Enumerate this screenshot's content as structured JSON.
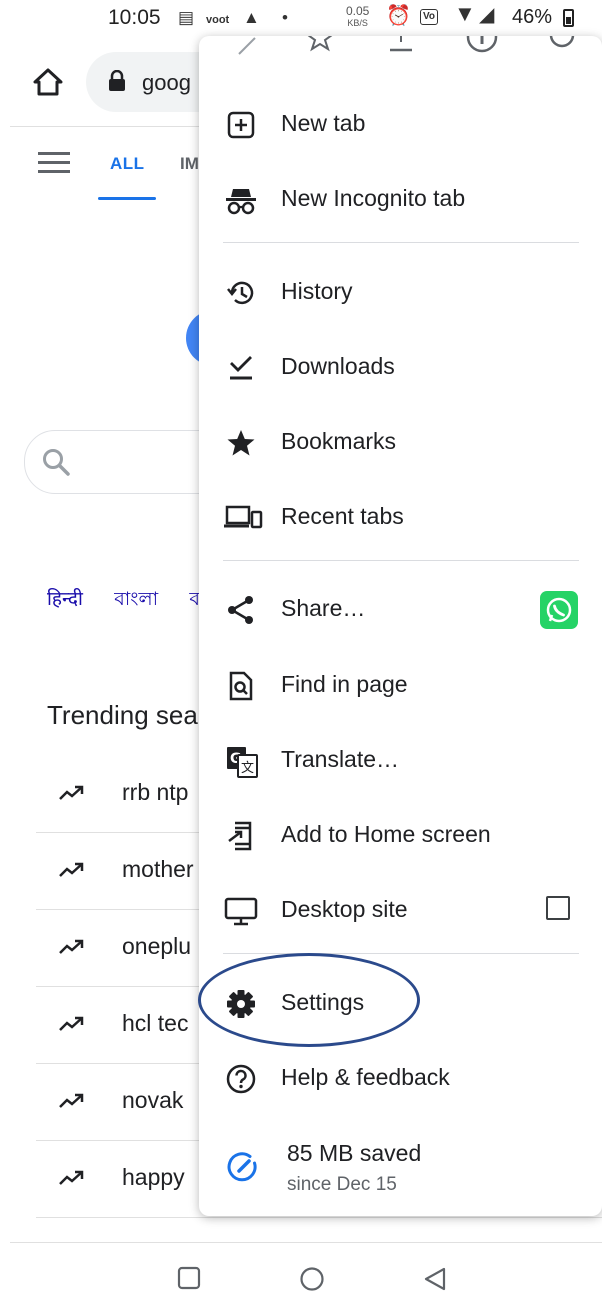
{
  "status_bar": {
    "time": "10:05",
    "speed_value": "0.05",
    "speed_unit": "KB/S",
    "battery": "46%",
    "icons": [
      "notification-icon",
      "voot-icon",
      "drive-icon",
      "dot-icon",
      "alarm-icon",
      "vowifi-icon",
      "wifi-icon",
      "signal-icon",
      "battery-icon"
    ]
  },
  "browser": {
    "url": "goog"
  },
  "page": {
    "tabs": [
      "ALL",
      "IM"
    ],
    "languages": [
      "हिन्दी",
      "বাংলা",
      "ব"
    ],
    "trending_title": "Trending sea",
    "trending": [
      "rrb ntp",
      "mother",
      "oneplu",
      "hcl tec",
      "novak",
      "happy"
    ]
  },
  "menu": {
    "items": [
      {
        "label": "New tab",
        "icon": "new-tab-icon"
      },
      {
        "label": "New Incognito tab",
        "icon": "incognito-icon"
      },
      {
        "label": "History",
        "icon": "history-icon"
      },
      {
        "label": "Downloads",
        "icon": "downloads-icon"
      },
      {
        "label": "Bookmarks",
        "icon": "bookmark-star-icon"
      },
      {
        "label": "Recent tabs",
        "icon": "devices-icon"
      },
      {
        "label": "Share…",
        "icon": "share-icon"
      },
      {
        "label": "Find in page",
        "icon": "find-in-page-icon"
      },
      {
        "label": "Translate…",
        "icon": "translate-icon"
      },
      {
        "label": "Add to Home screen",
        "icon": "add-to-home-icon"
      },
      {
        "label": "Desktop site",
        "icon": "desktop-icon"
      },
      {
        "label": "Settings",
        "icon": "gear-icon"
      },
      {
        "label": "Help & feedback",
        "icon": "help-icon"
      }
    ],
    "desktop_site_checked": false,
    "data_saver": {
      "amount": "85 MB saved",
      "since": "since Dec 15"
    }
  },
  "colors": {
    "accent": "#1a73e8",
    "highlight_ring": "#2b4a8c",
    "whatsapp": "#25d366"
  }
}
